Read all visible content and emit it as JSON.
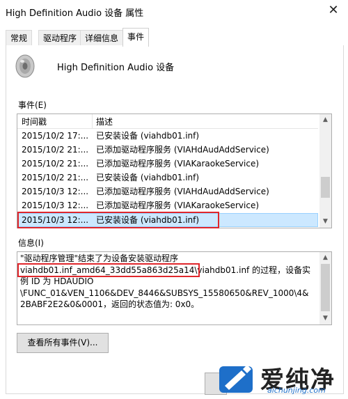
{
  "window": {
    "title": "High Definition Audio 设备 属性",
    "close_glyph": "✕"
  },
  "tabs": [
    {
      "label": "常规"
    },
    {
      "label": "驱动程序"
    },
    {
      "label": "详细信息"
    },
    {
      "label": "事件",
      "active": true
    }
  ],
  "device": {
    "name": "High Definition Audio 设备",
    "icon": "speaker-icon"
  },
  "events": {
    "label": "事件(E)",
    "columns": [
      "时间戳",
      "描述"
    ],
    "rows": [
      {
        "time": "2015/10/2 17:...",
        "desc": "已安装设备 (viahdb01.inf)"
      },
      {
        "time": "2015/10/2 21:...",
        "desc": "已添加驱动程序服务 (VIAHdAudAddService)"
      },
      {
        "time": "2015/10/2 21:...",
        "desc": "已添加驱动程序服务 (VIAKaraokeService)"
      },
      {
        "time": "2015/10/2 21:...",
        "desc": "已安装设备 (viahdb01.inf)"
      },
      {
        "time": "2015/10/3 12:...",
        "desc": "已添加驱动程序服务 (VIAHdAudAddService)"
      },
      {
        "time": "2015/10/3 12:...",
        "desc": "已添加驱动程序服务 (VIAKaraokeService)"
      },
      {
        "time": "2015/10/3 12:...",
        "desc": "已安装设备 (viahdb01.inf)",
        "selected": true
      }
    ],
    "scroll_position": 0.75
  },
  "info": {
    "label": "信息(I)",
    "lines": [
      "\"驱动程序管理\"结束了为设备安装驱动程序",
      "viahdb01.inf_amd64_33dd55a863d25a14\\viahdb01.inf 的过程，设备实",
      "例 ID 为 HDAUDIO",
      "\\FUNC_01&VEN_1106&DEV_8446&SUBSYS_15580650&REV_1000\\4&",
      "2BABF2E2&0&0001，返回的状态值为: 0x0。"
    ]
  },
  "buttons": {
    "view_all": "查看所有事件(V)..."
  },
  "watermark": {
    "text": "爱纯净",
    "url": "aichunjing.com",
    "color": "#1e6fc9"
  },
  "colors": {
    "selection": "#cce8ff",
    "highlight_box": "#e0262b"
  }
}
